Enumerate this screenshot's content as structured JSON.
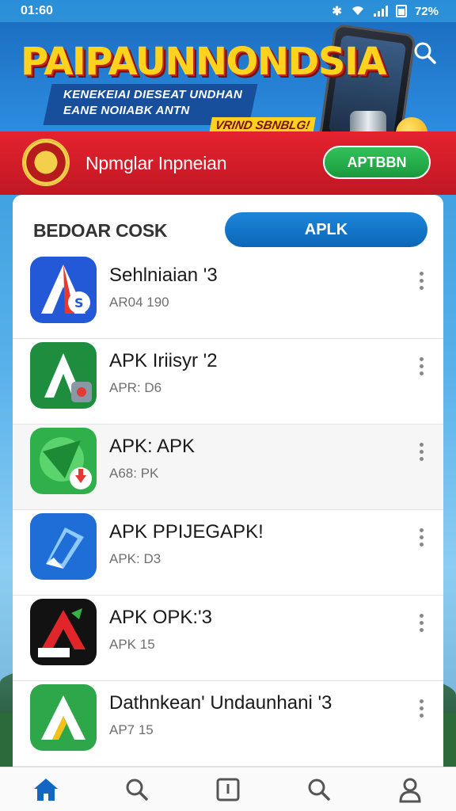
{
  "status_bar": {
    "time": "01:60",
    "battery": "72%"
  },
  "banner": {
    "title": "PAIPAUNNONDSIA",
    "subtitle_line1": "KENEKEIAI DIESEAT UNDHAN",
    "subtitle_line2": "EANE NOIIABK ANTN",
    "badge_prefix": "VRIND",
    "badge": "SBNBLG!"
  },
  "brand": {
    "name": "Npmglar Inpneian",
    "button_label": "APTBBN"
  },
  "section": {
    "title": "BEDOAR COSK",
    "pill_label": "APLK"
  },
  "apps": [
    {
      "name": "Sehlniaian '3",
      "meta": "AR04 190",
      "icon": "blue-a-icon",
      "bg": "#2358d6",
      "accent": "#e43a2f"
    },
    {
      "name": "APK Iriisyr '2",
      "meta": "APR: D6",
      "icon": "green-a-icon",
      "bg": "#1e8e3e",
      "accent": "#ffffff"
    },
    {
      "name": "APK: APK",
      "meta": "A68: PK",
      "icon": "green-arrow-icon",
      "bg": "#2fb04a",
      "accent": "#e53935"
    },
    {
      "name": "APK PPIJEGAPK!",
      "meta": "APK: D3",
      "icon": "blue-send-icon",
      "bg": "#1f6ed8",
      "accent": "#8ec9ff"
    },
    {
      "name": "APK OPK:'3",
      "meta": "APK 15",
      "icon": "black-a-icon",
      "bg": "#121212",
      "accent": "#e0262b"
    },
    {
      "name": "Dathnkean' Undaunhani '3",
      "meta": "AP7 15",
      "icon": "green-triangle-icon",
      "bg": "#2ea64a",
      "accent": "#f2c21b"
    }
  ],
  "nav": [
    {
      "name": "home-icon",
      "active": true
    },
    {
      "name": "search-icon"
    },
    {
      "name": "download-icon"
    },
    {
      "name": "search-icon"
    },
    {
      "name": "profile-icon"
    }
  ],
  "colors": {
    "accent_blue": "#0c66b8",
    "brand_red": "#c01723",
    "cta_green": "#1a9a3e"
  }
}
